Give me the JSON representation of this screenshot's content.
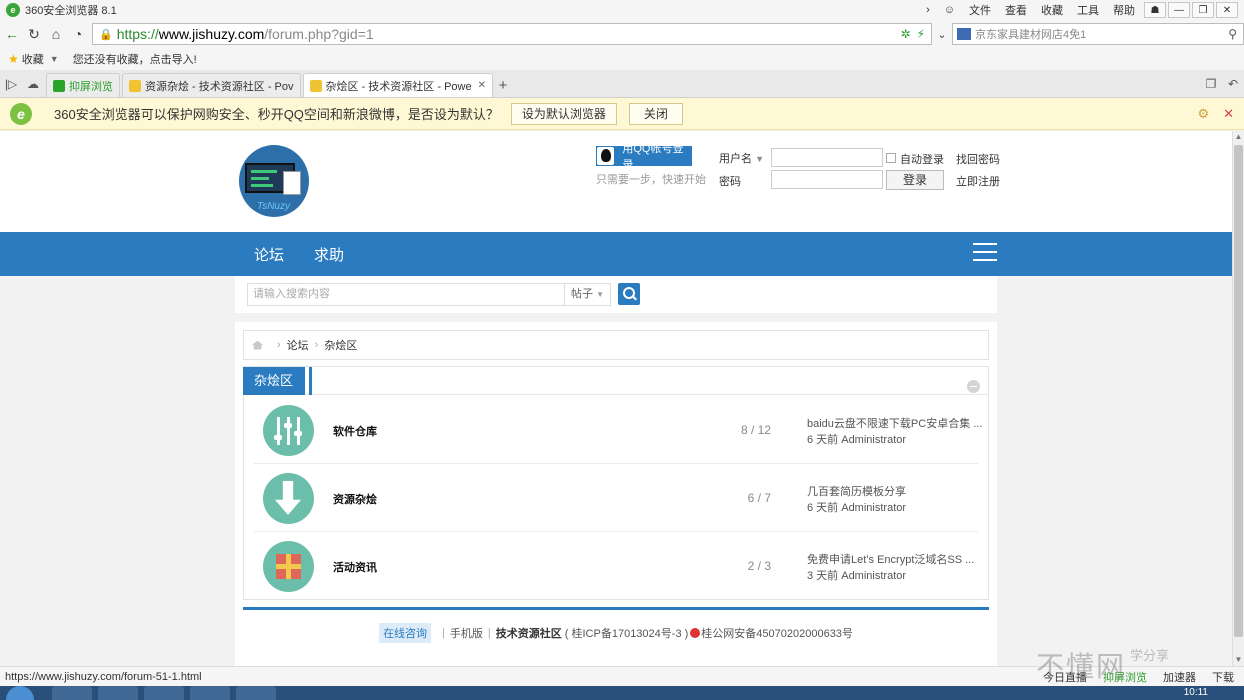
{
  "browser": {
    "title": "360安全浏览器 8.1",
    "menus": [
      "文件",
      "查看",
      "收藏",
      "工具",
      "帮助"
    ],
    "url": {
      "scheme": "https://",
      "host": "www.jishuzy.com",
      "path": "/forum.php?gid=1"
    },
    "search_placeholder": "京东家具建材网店4免1",
    "bookmarks_label": "收藏",
    "bookmarks_hint": "您还没有收藏，点击导入!",
    "tabs": [
      {
        "label": "抑屏浏览",
        "active": false
      },
      {
        "label": "资源杂烩 - 技术资源社区 - Pov",
        "active": false
      },
      {
        "label": "杂烩区 - 技术资源社区 - Powe",
        "active": true
      }
    ],
    "notify": {
      "message": "360安全浏览器可以保护网购安全、秒开QQ空间和新浪微博，是否设为默认？",
      "set_default": "设为默认浏览器",
      "close": "关闭"
    },
    "status_url": "https://www.jishuzy.com/forum-51-1.html",
    "status_items": [
      "今日直播",
      "抑屏浏览",
      "加速器",
      "下载"
    ],
    "clock": "10:11"
  },
  "header": {
    "logo_text": "TsNuzy",
    "qq_login": "用QQ帐号登录",
    "qq_hint": "只需要一步，快速开始",
    "username_label": "用户名",
    "password_label": "密码",
    "auto_login": "自动登录",
    "login_button": "登录",
    "find_password": "找回密码",
    "register": "立即注册"
  },
  "nav": {
    "items": [
      "论坛",
      "求助"
    ]
  },
  "search": {
    "placeholder": "请输入搜索内容",
    "type": "帖子"
  },
  "breadcrumb": [
    "论坛",
    "杂烩区"
  ],
  "forum": {
    "title": "杂烩区",
    "rows": [
      {
        "name": "软件仓库",
        "stats": "8 / 12",
        "last_title": "baidu云盘不限速下载PC安卓合集 ...",
        "last_meta": "6 天前 Administrator",
        "icon": "sliders-icon"
      },
      {
        "name": "资源杂烩",
        "stats": "6 / 7",
        "last_title": "几百套简历模板分享",
        "last_meta": "6 天前 Administrator",
        "icon": "download-arrow-icon"
      },
      {
        "name": "活动资讯",
        "stats": "2 / 3",
        "last_title": "免费申请Let’s Encrypt泛域名SS ...",
        "last_meta": "3 天前 Administrator",
        "icon": "gift-icon"
      }
    ]
  },
  "footer": {
    "online": "在线咨询",
    "mobile": "手机版",
    "site": "技术资源社区",
    "icp": "( 桂ICP备17013024号-3 )",
    "police": "桂公网安备45070202000633号"
  },
  "watermark": {
    "main": "不懂网",
    "sub": "学分享"
  }
}
